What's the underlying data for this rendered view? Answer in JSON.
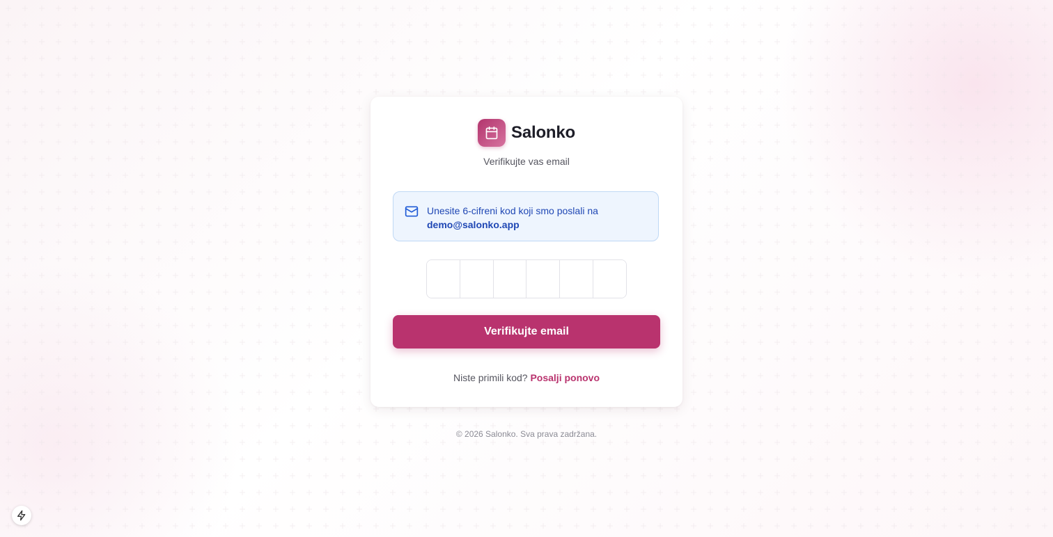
{
  "brand": {
    "name": "Salonko",
    "logo_icon": "calendar-icon",
    "accent_color": "#b9336e"
  },
  "page": {
    "subtitle": "Verifikujte vas email"
  },
  "info": {
    "icon": "mail-icon",
    "message": "Unesite 6-cifreni kod koji smo poslali na",
    "email": "demo@salonko.app"
  },
  "otp": {
    "length": 6,
    "values": [
      "",
      "",
      "",
      "",
      "",
      ""
    ]
  },
  "actions": {
    "verify_label": "Verifikujte email",
    "resend_prompt": "Niste primili kod?",
    "resend_link": "Posalji ponovo"
  },
  "footer": {
    "text": "© 2026 Salonko. Sva prava zadržana."
  },
  "dev_indicator": {
    "icon": "lightning-icon"
  }
}
